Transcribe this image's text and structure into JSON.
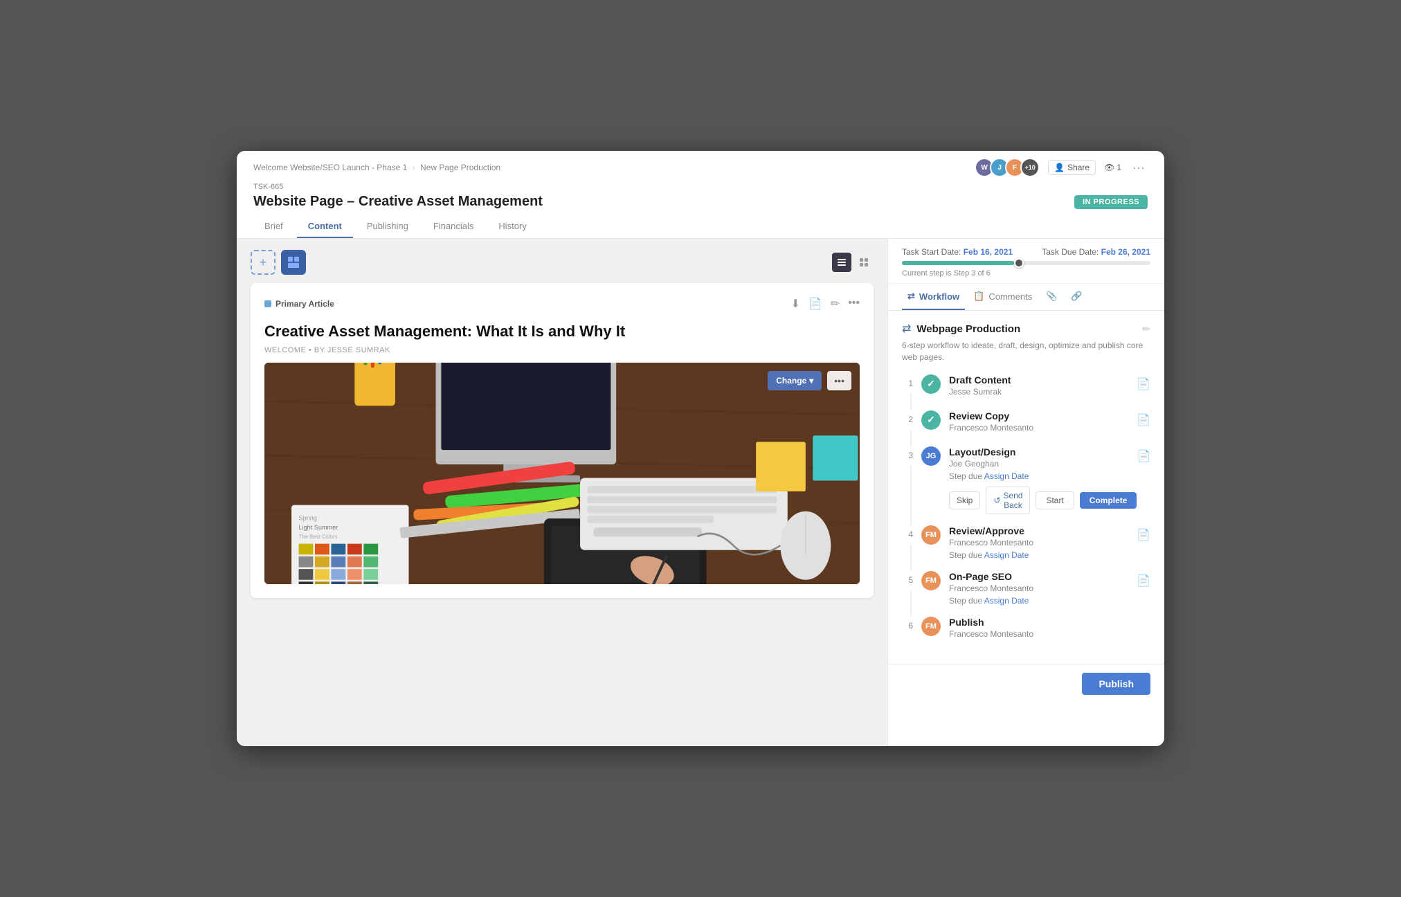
{
  "window": {
    "title": "Website Page - Creative Asset Management"
  },
  "breadcrumb": {
    "parts": [
      "Welcome Website/SEO Launch - Phase 1",
      "New Page Production"
    ]
  },
  "task": {
    "id": "TSK-665",
    "title": "Website Page – Creative Asset Management",
    "status": "IN PROGRESS"
  },
  "top_right": {
    "share_label": "Share",
    "eye_count": "1",
    "more_label": "···"
  },
  "tabs": [
    "Brief",
    "Content",
    "Publishing",
    "Financials",
    "History"
  ],
  "active_tab": "Content",
  "dates": {
    "start_label": "Task Start Date:",
    "start_val": "Feb 16, 2021",
    "due_label": "Task Due Date:",
    "due_val": "Feb 26, 2021",
    "step_info": "Current step is Step 3 of 6"
  },
  "sidebar_tabs": [
    "Workflow",
    "Comments",
    "attachments",
    "link"
  ],
  "active_sidebar_tab": "Workflow",
  "workflow": {
    "icon": "⇄",
    "title": "Webpage Production",
    "description": "6-step workflow to ideate, draft, design, optimize and publish core web pages.",
    "steps": [
      {
        "num": "1",
        "status": "complete",
        "title": "Draft Content",
        "assignee": "Jesse Sumrak",
        "due": null,
        "actions": []
      },
      {
        "num": "2",
        "status": "complete",
        "title": "Review Copy",
        "assignee": "Francesco Montesanto",
        "due": null,
        "actions": []
      },
      {
        "num": "3",
        "status": "active",
        "title": "Layout/Design",
        "assignee": "Joe Geoghan",
        "due_label": "Step due",
        "due_link": "Assign Date",
        "actions": [
          "Skip",
          "Send Back",
          "Start",
          "Complete"
        ]
      },
      {
        "num": "4",
        "status": "pending",
        "title": "Review/Approve",
        "assignee": "Francesco Montesanto",
        "due_label": "Step due",
        "due_link": "Assign Date",
        "actions": []
      },
      {
        "num": "5",
        "status": "pending",
        "title": "On-Page SEO",
        "assignee": "Francesco Montesanto",
        "due_label": "Step due",
        "due_link": "Assign Date",
        "actions": []
      },
      {
        "num": "6",
        "status": "pending",
        "title": "Publish",
        "assignee": "Francesco Montesanto",
        "due_label": null,
        "due_link": null,
        "actions": []
      }
    ]
  },
  "article": {
    "label": "Primary Article",
    "heading": "Creative Asset Management: What It Is and Why It",
    "byline": "WELCOME • BY JESSE SUMRAK",
    "change_btn": "Change",
    "image_alt": "Designer workspace with keyboard, mouse, color swatches and tablet"
  },
  "swatches": [
    "#c8b400",
    "#e8c200",
    "#f0d040",
    "#a89800",
    "#806e00",
    "#2a6496",
    "#3a80be",
    "#5aacdc",
    "#1a4a6a",
    "#0a2a3a",
    "#c83a1a",
    "#e85a30",
    "#f07858",
    "#a83018",
    "#781808",
    "#2a9840",
    "#3abc5a",
    "#5ad878",
    "#1a7830",
    "#0a4818",
    "#888",
    "#aaa",
    "#ccc",
    "#666",
    "#444",
    "#8a6a20",
    "#b08a30",
    "#d0aa58",
    "#6a4a10",
    "#3a2808"
  ],
  "icons": {
    "download": "⬇",
    "doc": "📄",
    "edit": "✏",
    "more": "•••",
    "list_view": "▪▪▪",
    "grid_view": "⊞",
    "check": "✓",
    "share": "👤",
    "eye": "👁",
    "refresh": "↺"
  },
  "publish_bar": {
    "label": "Publish"
  }
}
